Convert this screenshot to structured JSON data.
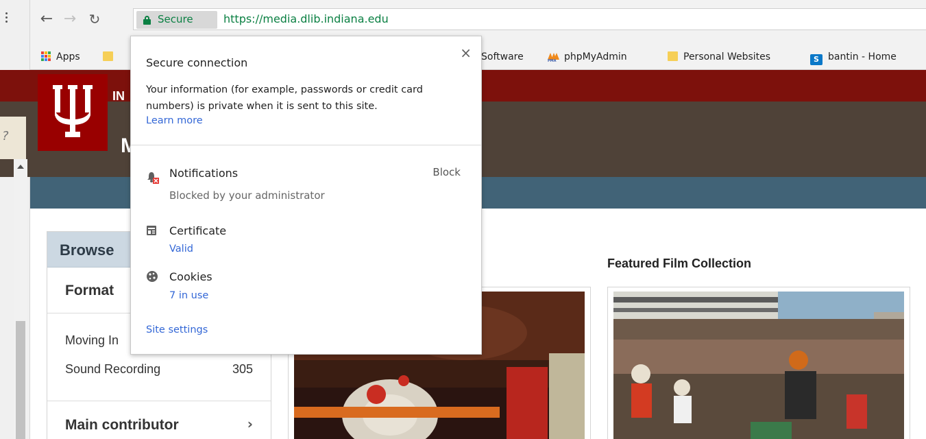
{
  "browser": {
    "secure_label": "Secure",
    "url": "https://media.dlib.indiana.edu"
  },
  "bookmarks": [
    {
      "label": "Apps",
      "icon": "apps-grid-icon"
    },
    {
      "label": "Software",
      "icon": "folder-icon"
    },
    {
      "label": "phpMyAdmin",
      "icon": "phpmyadmin-icon"
    },
    {
      "label": "Personal Websites",
      "icon": "folder-icon"
    },
    {
      "label": "bantin - Home",
      "icon": "sharepoint-icon"
    }
  ],
  "popup": {
    "close_symbol": "×",
    "title": "Secure connection",
    "description": "Your information (for example, passwords or credit card numbers) is private when it is sent to this site.",
    "learn_more": "Learn more",
    "notifications": {
      "label": "Notifications",
      "sub": "Blocked by your administrator",
      "value": "Block"
    },
    "certificate": {
      "label": "Certificate",
      "link": "Valid"
    },
    "cookies": {
      "label": "Cookies",
      "link": "7 in use"
    },
    "site_settings": "Site settings"
  },
  "page": {
    "header_partial": "IN",
    "site_title_partial": "M",
    "sidebar": {
      "title_partial": "Browse",
      "format_heading_partial": "Format",
      "items": [
        {
          "label": "Moving In",
          "count": ""
        },
        {
          "label": "Sound Recording",
          "count": "305"
        }
      ],
      "main_contributor": "Main contributor"
    },
    "featured_heading": "Featured Film Collection"
  },
  "colors": {
    "secure_green": "#0b8043",
    "link_blue": "#3367d6",
    "iu_crimson": "#990000",
    "iu_bar": "#7d110c",
    "brown_band": "#4f4238",
    "blue_band": "#416377"
  }
}
